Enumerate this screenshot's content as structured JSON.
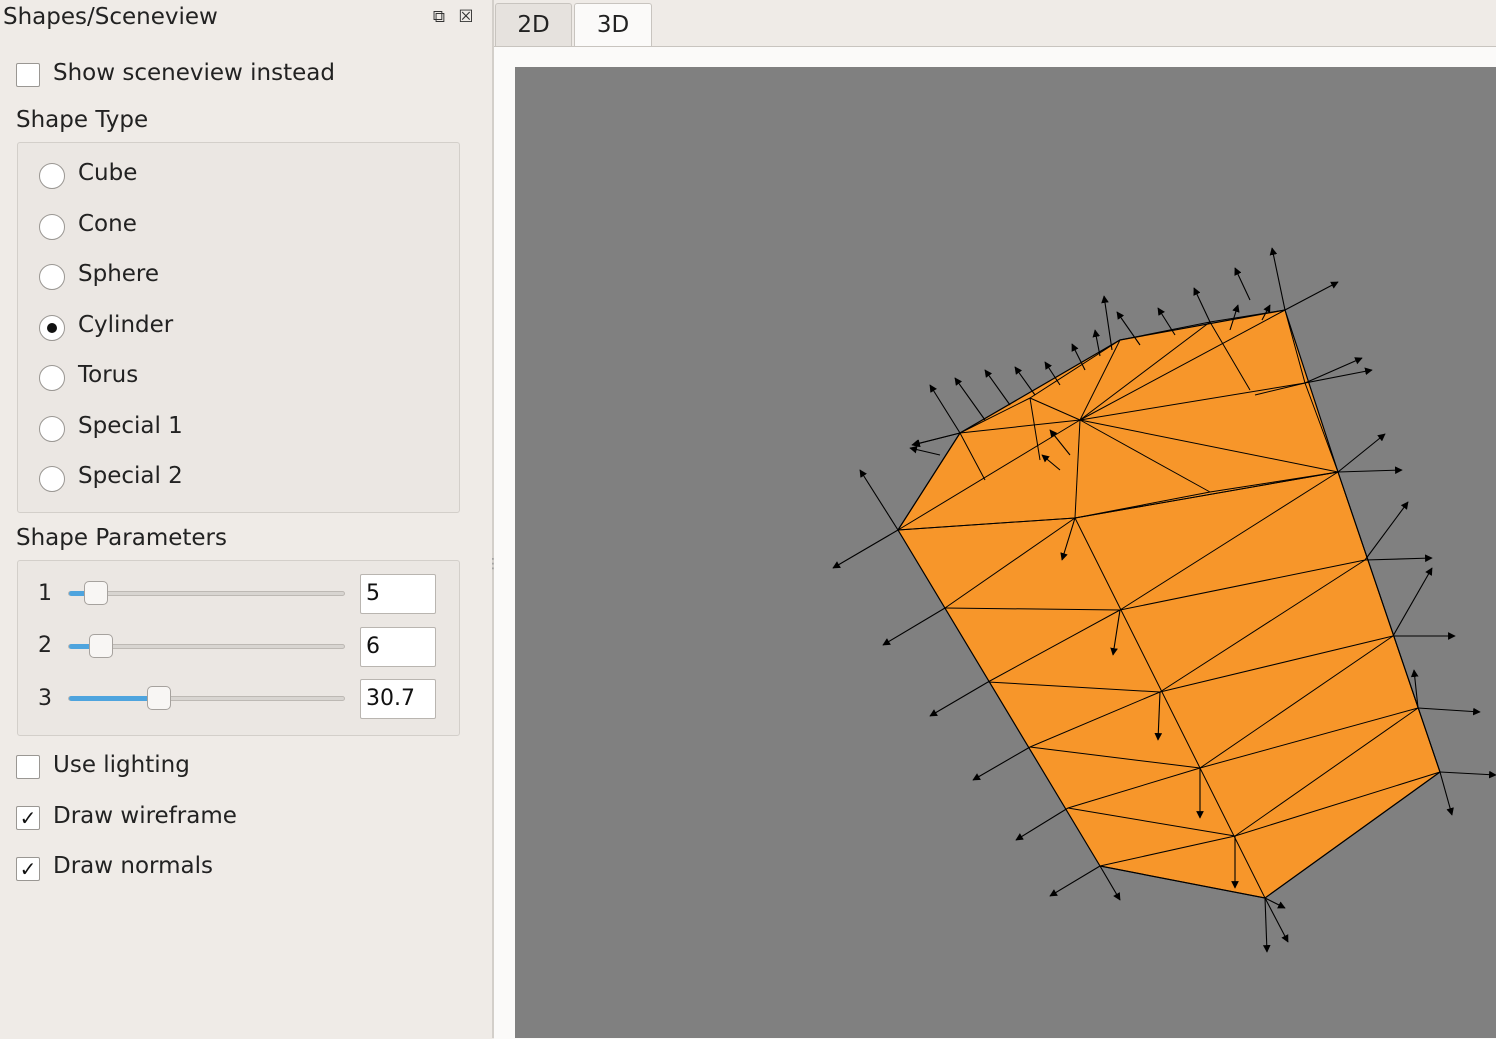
{
  "dock": {
    "title": "Shapes/Sceneview",
    "float_icon": "restore-icon",
    "close_icon": "close-icon",
    "show_sceneview": {
      "label": "Show sceneview instead",
      "checked": false
    },
    "shape_type": {
      "title": "Shape Type",
      "options": [
        {
          "label": "Cube",
          "selected": false
        },
        {
          "label": "Cone",
          "selected": false
        },
        {
          "label": "Sphere",
          "selected": false
        },
        {
          "label": "Cylinder",
          "selected": true
        },
        {
          "label": "Torus",
          "selected": false
        },
        {
          "label": "Special 1",
          "selected": false
        },
        {
          "label": "Special 2",
          "selected": false
        }
      ]
    },
    "shape_parameters": {
      "title": "Shape Parameters",
      "params": [
        {
          "label": "1",
          "value": "5",
          "fraction": 0.06
        },
        {
          "label": "2",
          "value": "6",
          "fraction": 0.08
        },
        {
          "label": "3",
          "value": "30.7",
          "fraction": 0.31
        }
      ]
    },
    "use_lighting": {
      "label": "Use lighting",
      "checked": false
    },
    "draw_wireframe": {
      "label": "Draw wireframe",
      "checked": true
    },
    "draw_normals": {
      "label": "Draw normals",
      "checked": true
    }
  },
  "tabs": [
    {
      "label": "2D",
      "active": false
    },
    {
      "label": "3D",
      "active": true
    }
  ],
  "viewport": {
    "background_color": "#808080",
    "shape_color": "#f7962a",
    "wire_color": "#000000"
  }
}
